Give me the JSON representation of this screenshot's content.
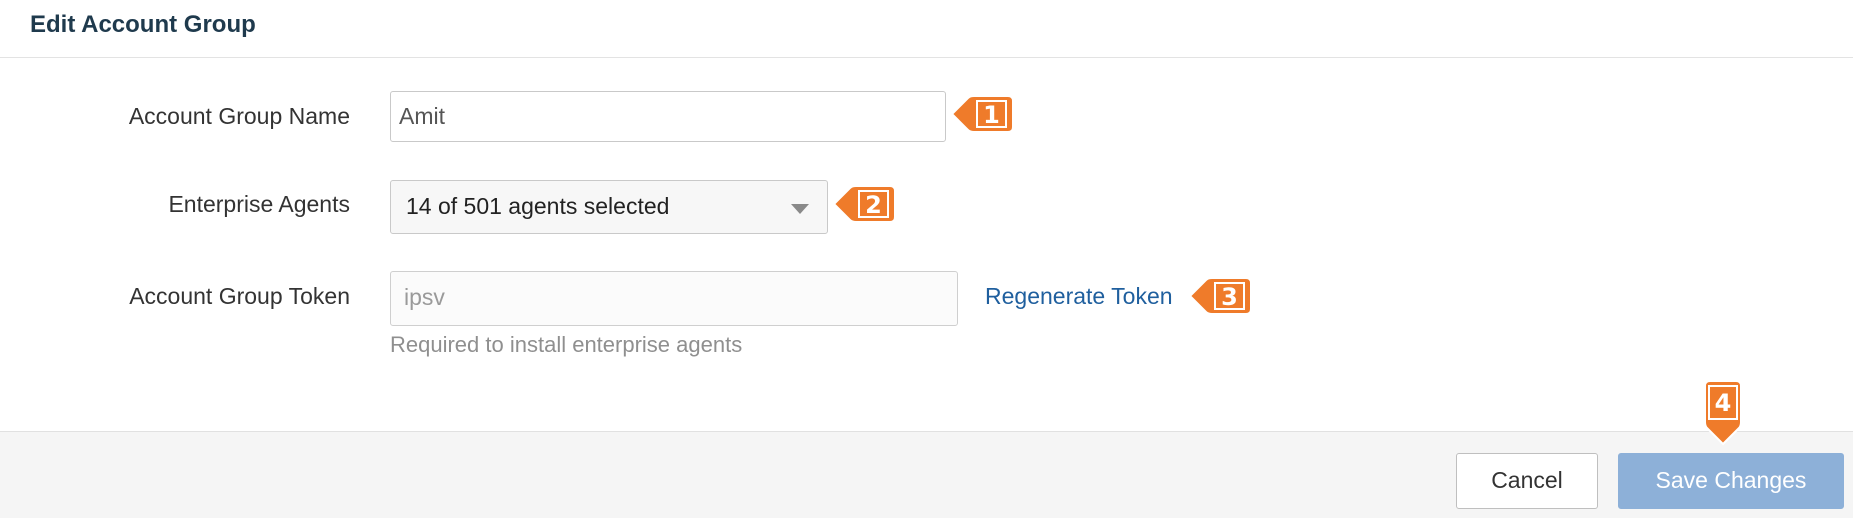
{
  "dialog": {
    "title": "Edit Account Group"
  },
  "form": {
    "name_label": "Account Group Name",
    "name_value": "Amit",
    "agents_label": "Enterprise Agents",
    "agents_selected": "14 of 501 agents selected",
    "token_label": "Account Group Token",
    "token_value": "ipsv",
    "regenerate_label": "Regenerate Token",
    "token_helper": "Required to install enterprise agents"
  },
  "footer": {
    "cancel_label": "Cancel",
    "save_label": "Save Changes"
  },
  "callouts": {
    "c1": "1",
    "c2": "2",
    "c3": "3",
    "c4": "4"
  },
  "colors": {
    "callout": "#ef7b2a",
    "title": "#1f3a4d",
    "link": "#1f5f9e",
    "save_button": "#8db0d8"
  }
}
